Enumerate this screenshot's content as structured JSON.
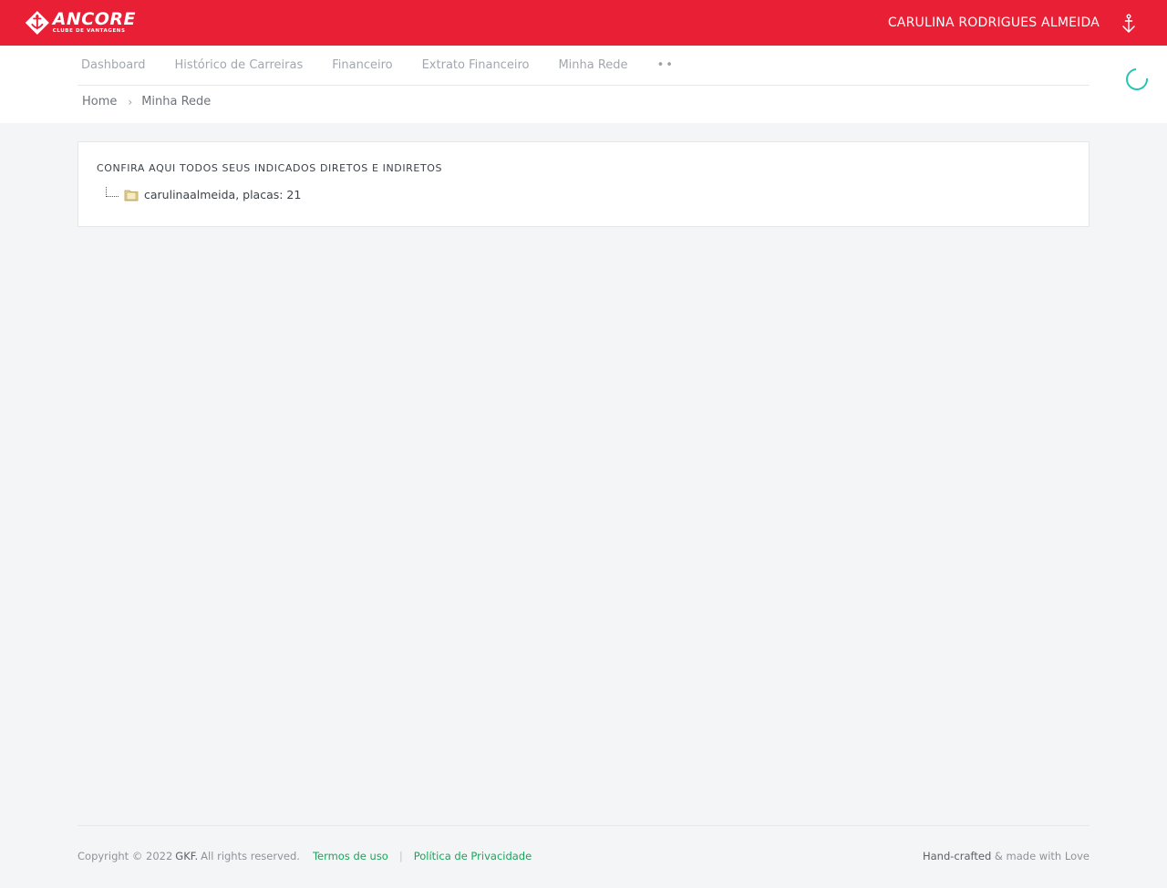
{
  "header": {
    "logo_title": "ANCORE",
    "logo_subtitle": "CLUBE DE VANTAGENS",
    "user_name": "CARULINA RODRIGUES ALMEIDA",
    "brand_color": "#e81f35"
  },
  "menu": {
    "items": [
      {
        "label": "Dashboard"
      },
      {
        "label": "Histórico de Carreiras"
      },
      {
        "label": "Financeiro"
      },
      {
        "label": "Extrato Financeiro"
      },
      {
        "label": "Minha Rede"
      }
    ],
    "more_label": "••"
  },
  "breadcrumb": {
    "home": "Home",
    "separator": "›",
    "current": "Minha Rede"
  },
  "card": {
    "title": "CONFIRA AQUI TODOS SEUS INDICADOS DIRETOS E INDIRETOS",
    "tree": [
      {
        "label": "carulinaalmeida, placas: 21",
        "icon": "folder-icon"
      }
    ]
  },
  "footer": {
    "copyright_prefix": "Copyright © 2022",
    "brand": "GKF.",
    "rights": "All rights reserved.",
    "terms_link": "Termos de uso",
    "divider": "|",
    "privacy_link": "Política de Privacidade",
    "handcrafted": "Hand-crafted",
    "made_with": "& made with Love",
    "link_color": "#1aa55b"
  }
}
